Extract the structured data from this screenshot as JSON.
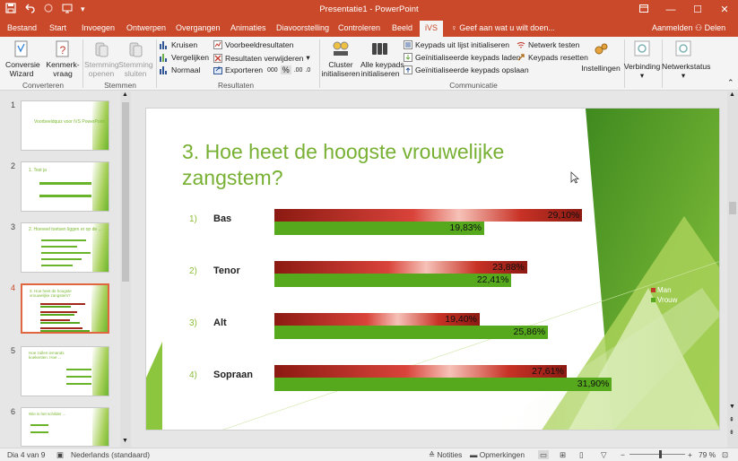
{
  "window": {
    "title": "Presentatie1 - PowerPoint",
    "controls": [
      "restore-icon",
      "minimize-icon",
      "maximize-icon",
      "close-icon"
    ]
  },
  "qat": {
    "save": "💾",
    "undo": "↶",
    "redo": "↷",
    "more": "▾"
  },
  "tabs": [
    {
      "label": "Bestand"
    },
    {
      "label": "Start"
    },
    {
      "label": "Invoegen"
    },
    {
      "label": "Ontwerpen"
    },
    {
      "label": "Overgangen"
    },
    {
      "label": "Animaties"
    },
    {
      "label": "Diavoorstelling"
    },
    {
      "label": "Controleren"
    },
    {
      "label": "Beeld"
    },
    {
      "label": "iVS"
    }
  ],
  "tell_me": "Geef aan wat u wilt doen...",
  "sign_in": "Aanmelden",
  "share": "Delen",
  "ribbon": {
    "converteren": {
      "label": "Converteren",
      "conversie": [
        "Conversie",
        "Wizard"
      ],
      "kenmerk": [
        "Kenmerk-",
        "vraag"
      ]
    },
    "stemmen": {
      "label": "Stemmen",
      "openen": [
        "Stemming",
        "openen"
      ],
      "sluiten": [
        "Stemming",
        "sluiten"
      ]
    },
    "resultaten": {
      "label": "Resultaten",
      "kruisen": "Kruisen",
      "vergelijken": "Vergelijken",
      "normaal": "Normaal",
      "voorbeeld": "Voorbeeldresultaten",
      "verwijderen": "Resultaten verwijderen",
      "exporteren": "Exporteren",
      "fmt_000": "000",
      "fmt_pct": "%",
      "fmt_inc": ".00",
      "fmt_dec": ".0"
    },
    "communicatie": {
      "label": "Communicatie",
      "cluster": [
        "Cluster",
        "initialiseren"
      ],
      "alle": [
        "Alle keypads",
        "initialiseren"
      ],
      "lijst": "Keypads uit lijst initialiseren",
      "laden": "Geïnitialiseerde keypads laden",
      "opslaan": "Geïnitialiseerde keypads opslaan",
      "netwerk": "Netwerk testen",
      "resetten": "Keypads resetten",
      "instellingen": "Instellingen"
    },
    "verbinding": "Verbinding",
    "netwerkstatus": "Netwerkstatus"
  },
  "thumbnails": [
    {
      "num": "1",
      "title": "Voorbeeldquiz voor iVS PowerPoint"
    },
    {
      "num": "2",
      "title": "1. Test ja"
    },
    {
      "num": "3",
      "title": "2. Hoeveel toetsen liggen er op de ..."
    },
    {
      "num": "4",
      "title": "3. Hoe heet de hoogste vrouwelijke zangstem?"
    },
    {
      "num": "5",
      "title": "Hoe zullen iemands koekenten. Hoe ..."
    },
    {
      "num": "6",
      "title": "Wie is het schilder ..."
    }
  ],
  "slide": {
    "title": "3.  Hoe heet de hoogste vrouwelijke zangstem?"
  },
  "chart_data": {
    "type": "bar",
    "orientation": "horizontal",
    "categories": [
      "Bas",
      "Tenor",
      "Alt",
      "Sopraan"
    ],
    "category_numbers": [
      "1)",
      "2)",
      "3)",
      "4)"
    ],
    "series": [
      {
        "name": "Man",
        "values": [
          29.1,
          23.88,
          19.4,
          27.61
        ],
        "labels": [
          "29,10%",
          "23,88%",
          "19,40%",
          "27,61%"
        ],
        "color": "#c0392b"
      },
      {
        "name": "Vrouw",
        "values": [
          19.83,
          22.41,
          25.86,
          31.9
        ],
        "labels": [
          "19,83%",
          "22,41%",
          "25,86%",
          "31,90%"
        ],
        "color": "#56a91d"
      }
    ],
    "legend_position": "right"
  },
  "status": {
    "slide": "Dia 4 van 9",
    "language": "Nederlands (standaard)",
    "notes": "Notities",
    "comments": "Opmerkingen",
    "zoom": "79 %"
  },
  "colors": {
    "accent": "#c9492a",
    "green": "#77b032"
  }
}
